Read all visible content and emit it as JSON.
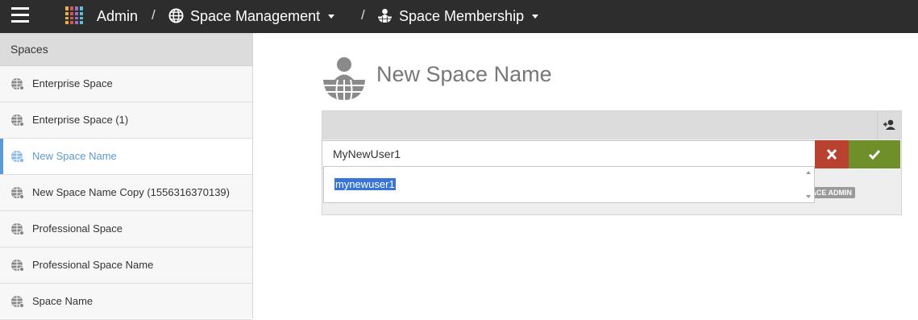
{
  "topbar": {
    "menu_icon": "hamburger-icon",
    "app_icon": "app-logo-icon",
    "admin_label": "Admin",
    "separator": "/",
    "space_management_label": "Space Management",
    "space_management_icon": "globe-icon",
    "space_membership_label": "Space Membership",
    "space_membership_icon": "space-user-icon"
  },
  "sidebar": {
    "header": "Spaces",
    "items": [
      {
        "label": "Enterprise Space"
      },
      {
        "label": "Enterprise Space (1)"
      },
      {
        "label": "New Space Name"
      },
      {
        "label": "New Space Name Copy (1556316370139)"
      },
      {
        "label": "Professional Space"
      },
      {
        "label": "Professional Space Name"
      },
      {
        "label": "Space Name"
      }
    ],
    "active_label": "New Space Name"
  },
  "main": {
    "space_title": "New Space Name",
    "member_input_value": "MyNewUser1",
    "suggestion": "mynewuser1",
    "role_badge": "SPACE ADMIN",
    "add_member_icon": "add-user-icon",
    "cancel_icon": "close-icon",
    "confirm_icon": "check-icon"
  },
  "colors": {
    "topbar": "#2d2d2d",
    "accent": "#5a9bd5",
    "cancel": "#b9412f",
    "confirm": "#6e8f2a",
    "selection": "#3875d7"
  }
}
